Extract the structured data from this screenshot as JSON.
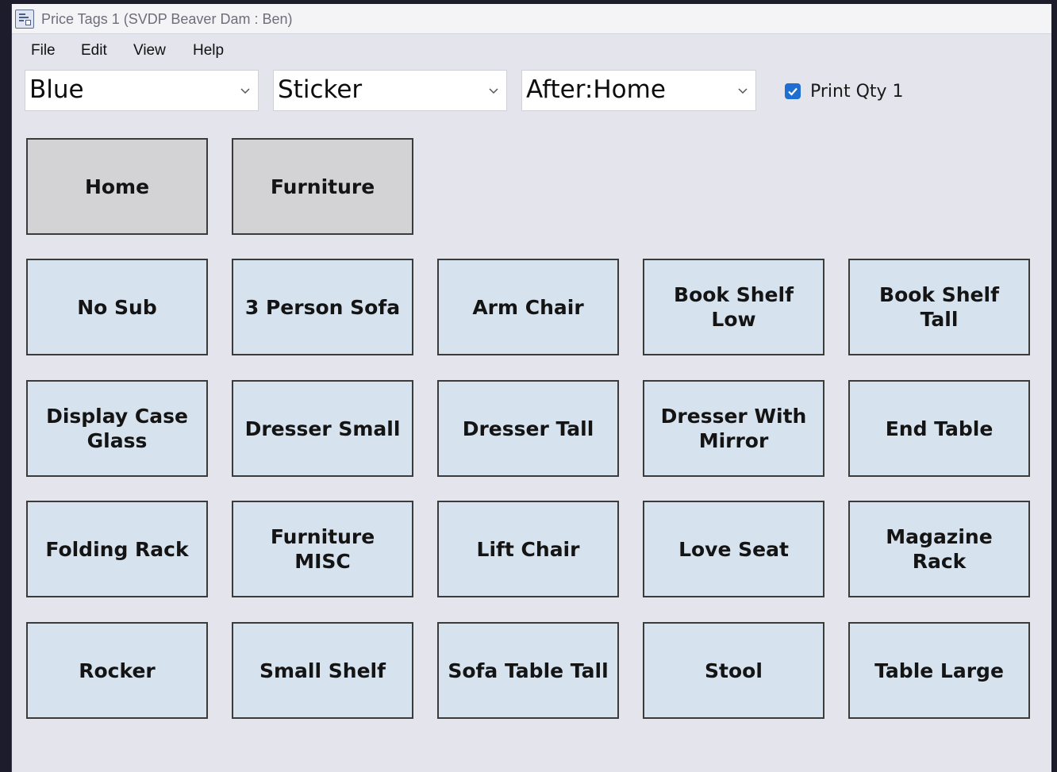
{
  "window": {
    "title": "Price Tags 1  (SVDP Beaver Dam : Ben)"
  },
  "menu": [
    "File",
    "Edit",
    "View",
    "Help"
  ],
  "dropdowns": {
    "color": "Blue",
    "tag_type": "Sticker",
    "after": "After:Home"
  },
  "print_qty": {
    "label": "Print Qty 1",
    "checked": true
  },
  "nav_buttons": [
    "Home",
    "Furniture"
  ],
  "item_buttons": [
    "No Sub",
    "3 Person Sofa",
    "Arm Chair",
    "Book Shelf Low",
    "Book Shelf Tall",
    "Display Case Glass",
    "Dresser Small",
    "Dresser Tall",
    "Dresser With Mirror",
    "End Table",
    "Folding Rack",
    "Furniture MISC",
    "Lift Chair",
    "Love Seat",
    "Magazine Rack",
    "Rocker",
    "Small Shelf",
    "Sofa Table Tall",
    "Stool",
    "Table Large"
  ],
  "colors": {
    "tile_item_bg": "#d6e2ee",
    "tile_nav_bg": "#d3d3d5",
    "window_bg": "#e3e4ec",
    "checkbox_accent": "#1e6fd1"
  },
  "icons": {
    "app": "price-tags-app-icon",
    "dropdown": "chevron-down-icon",
    "checkbox": "checkmark-icon"
  }
}
